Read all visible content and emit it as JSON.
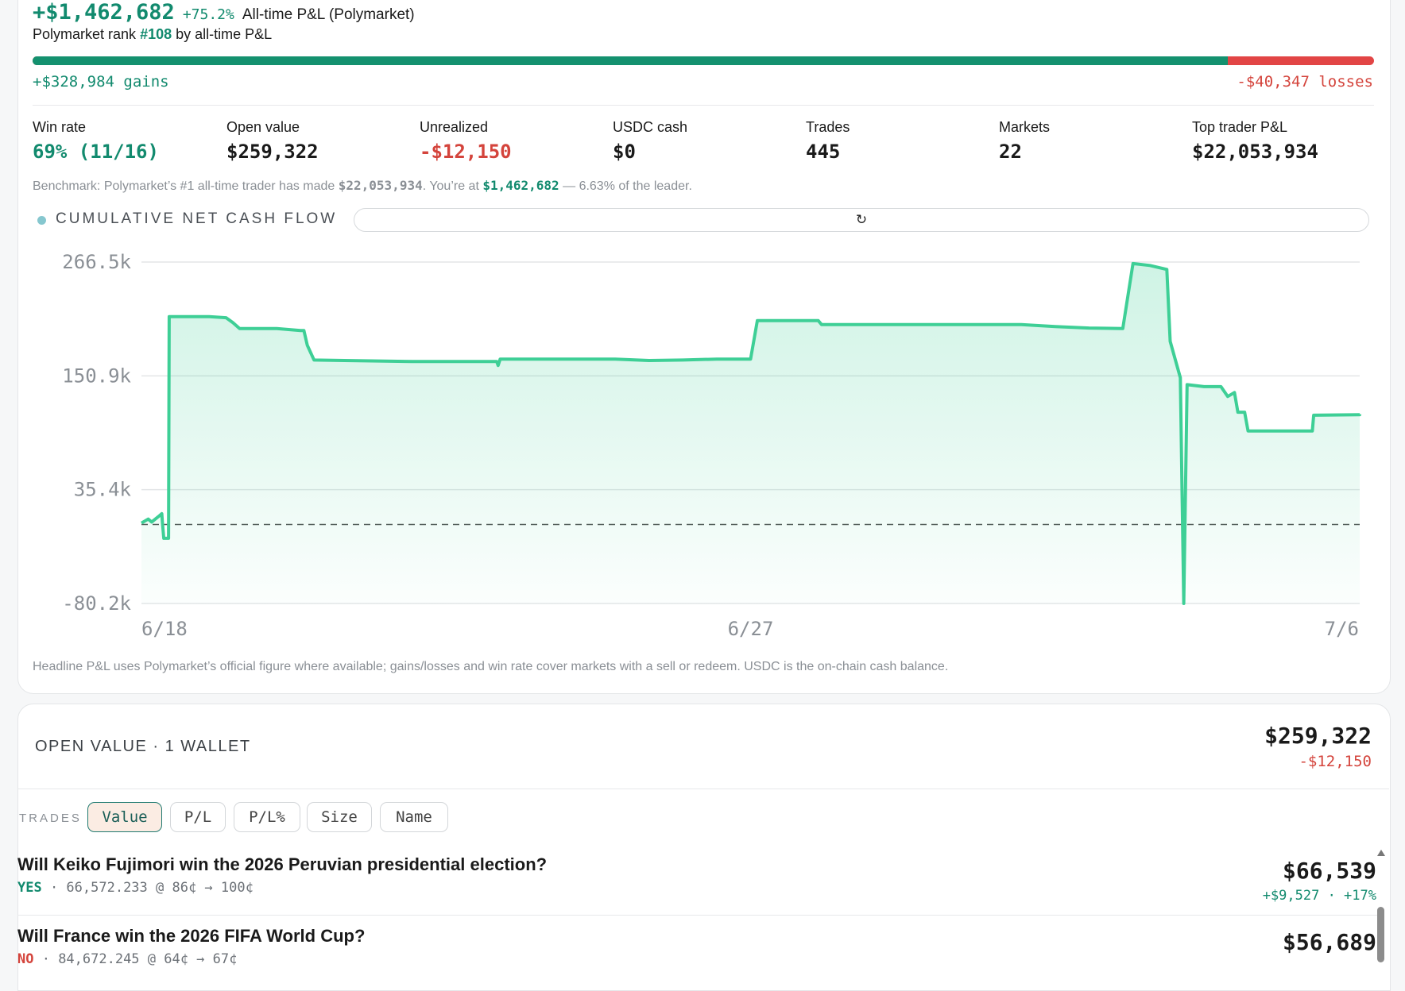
{
  "headline": {
    "pnl": "+$1,462,682",
    "pct": "+75.2%",
    "label": "All-time P&L (Polymarket)"
  },
  "rank": {
    "prefix": "Polymarket rank",
    "value": "#108",
    "suffix": "by all-time P&L"
  },
  "gains_losses": {
    "gains_fraction": 0.891,
    "gains": "+$328,984 gains",
    "losses": "-$40,347 losses"
  },
  "stats": [
    {
      "label": "Win rate",
      "value": "69% (11/16)",
      "tone": "green"
    },
    {
      "label": "Open value",
      "value": "$259,322",
      "tone": "dark"
    },
    {
      "label": "Unrealized",
      "value": "-$12,150",
      "tone": "red"
    },
    {
      "label": "USDC cash",
      "value": "$0",
      "tone": "dark"
    },
    {
      "label": "Trades",
      "value": "445",
      "tone": "dark"
    },
    {
      "label": "Markets",
      "value": "22",
      "tone": "dark"
    },
    {
      "label": "Top trader P&L",
      "value": "$22,053,934",
      "tone": "dark"
    }
  ],
  "benchmark": {
    "text1": "Benchmark: Polymarket’s #1 all-time trader has made ",
    "leader": "$22,053,934",
    "text2": ". You’re at ",
    "you": "$1,462,682",
    "text3": " — 6.63% of the leader."
  },
  "chart_header": {
    "title": "CUMULATIVE NET CASH FLOW",
    "reset_icon": "↻"
  },
  "chart_data": {
    "type": "area",
    "title": "CUMULATIVE NET CASH FLOW",
    "xlabel": "",
    "ylabel": "",
    "x_tick_labels": [
      "6/18",
      "6/27",
      "7/6"
    ],
    "y_tick_labels": [
      "266.5k",
      "150.9k",
      "35.4k",
      "-80.2k"
    ],
    "x_range_days": [
      0,
      18
    ],
    "ylim": [
      -80200,
      266500
    ],
    "grid": true,
    "baseline": 0,
    "baseline_style": "dashed",
    "color": "#3ecf96",
    "series": [
      {
        "values_note": "",
        "points": [
          [
            0.0,
            1500
          ],
          [
            0.1,
            5500
          ],
          [
            0.15,
            2500
          ],
          [
            0.25,
            8000
          ],
          [
            0.3,
            11000
          ],
          [
            0.31,
            2000
          ],
          [
            0.33,
            -14000
          ],
          [
            0.4,
            -14000
          ],
          [
            0.41,
            211000
          ],
          [
            1.0,
            211000
          ],
          [
            1.25,
            210000
          ],
          [
            1.35,
            205000
          ],
          [
            1.45,
            199000
          ],
          [
            2.0,
            199000
          ],
          [
            2.35,
            197000
          ],
          [
            2.4,
            197000
          ],
          [
            2.45,
            182000
          ],
          [
            2.55,
            167000
          ],
          [
            3.0,
            166500
          ],
          [
            4.0,
            165500
          ],
          [
            5.25,
            165500
          ],
          [
            5.27,
            161500
          ],
          [
            5.3,
            168000
          ],
          [
            6.0,
            168000
          ],
          [
            7.0,
            168000
          ],
          [
            7.5,
            166500
          ],
          [
            8.0,
            167000
          ],
          [
            8.5,
            168000
          ],
          [
            9.0,
            168000
          ],
          [
            9.1,
            207000
          ],
          [
            10.0,
            207000
          ],
          [
            10.05,
            203000
          ],
          [
            11.0,
            203000
          ],
          [
            12.0,
            203000
          ],
          [
            13.0,
            203000
          ],
          [
            13.5,
            201000
          ],
          [
            14.0,
            199500
          ],
          [
            14.5,
            199000
          ],
          [
            14.65,
            265000
          ],
          [
            14.9,
            263000
          ],
          [
            15.15,
            259000
          ],
          [
            15.2,
            186000
          ],
          [
            15.35,
            149000
          ],
          [
            15.4,
            -80200
          ],
          [
            15.45,
            142000
          ],
          [
            15.7,
            140000
          ],
          [
            15.95,
            140000
          ],
          [
            16.05,
            130000
          ],
          [
            16.15,
            134000
          ],
          [
            16.2,
            114000
          ],
          [
            16.3,
            114000
          ],
          [
            16.35,
            95000
          ],
          [
            17.0,
            95000
          ],
          [
            17.3,
            95000
          ],
          [
            17.32,
            111000
          ],
          [
            18.0,
            111500
          ],
          [
            18.3,
            112000
          ]
        ]
      }
    ]
  },
  "footnote": "Headline P&L uses Polymarket’s official figure where available; gains/losses and win rate cover markets with a sell or redeem. USDC is the on-chain cash balance.",
  "open_value": {
    "title": "OPEN VALUE · 1 WALLET",
    "value": "$259,322",
    "delta": "-$12,150"
  },
  "sort": {
    "label": "TRADES",
    "options": [
      "Value",
      "P/L",
      "P/L%",
      "Size",
      "Name"
    ],
    "active_index": 0
  },
  "trades": [
    {
      "question": "Will Keiko Fujimori win the 2026 Peruvian presidential election?",
      "side": "YES",
      "side_tone": "green",
      "detail": " · 66,572.233 @ 86¢ → 100¢",
      "value": "$66,539",
      "change": "+$9,527 · +17%",
      "change_tone": "green"
    },
    {
      "question": "Will France win the 2026 FIFA World Cup?",
      "side": "NO",
      "side_tone": "red",
      "detail": " · 84,672.245 @ 64¢ → 67¢",
      "value": "$56,689",
      "change": "",
      "change_tone": "green"
    }
  ]
}
